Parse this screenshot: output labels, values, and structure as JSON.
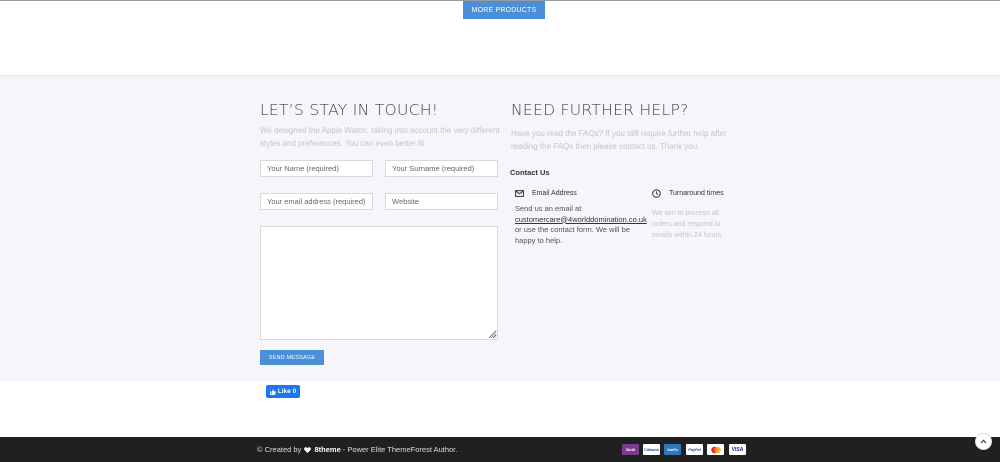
{
  "more_products": {
    "label": "MORE PRODUCTS"
  },
  "stay_in_touch": {
    "title": "LET’S STAY IN TOUCH!",
    "description": "We designed the Apple Watch, taking into account the very different styles and preferences. You can even better fit.",
    "form": {
      "name_placeholder": "Your Name (required)",
      "surname_placeholder": "Your Surname (required)",
      "email_placeholder": "Your email address (required)",
      "website_placeholder": "Website",
      "message_placeholder": "",
      "send_label": "SEND MESSAGE"
    }
  },
  "help": {
    "title": "NEED FURTHER HELP?",
    "description": "Have you read the FAQs? If you still require further help after reading the FAQs then please contact us. Thank you.",
    "contact_us": "Contact Us",
    "email": {
      "label": "Email Address",
      "line1": "Send us an email at",
      "address": "customercare@4worlddomination.co.uk",
      "line2": "or use the contact form. We will be",
      "line3": "happy to help."
    },
    "turnaround": {
      "label": "Turnaround times",
      "line1": "We aim to process all",
      "line2": "orders and respond to",
      "line3": "emails within 24 hours."
    }
  },
  "facebook": {
    "like_label": "Like 0"
  },
  "footer": {
    "created_by": "© Created by",
    "brand": "8theme",
    "tagline": "- Power Elite ThemeForest Author.",
    "payments": [
      "Skrill",
      "Citibank",
      "AmEx",
      "PayPal",
      "MasterCard",
      "VISA"
    ]
  },
  "colors": {
    "accent": "#4a8fd8",
    "footer_bg": "#202020",
    "section_bg": "#f6f5f9"
  },
  "icons": [
    "envelope-icon",
    "clock-icon",
    "heart-icon",
    "thumbs-up-icon",
    "chevron-up-icon"
  ]
}
